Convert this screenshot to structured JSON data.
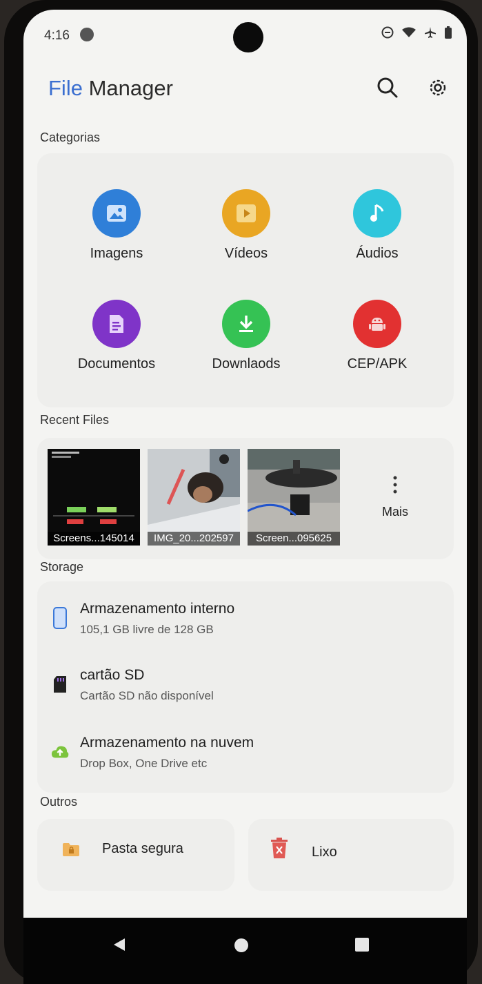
{
  "status": {
    "time": "4:16"
  },
  "header": {
    "title_accent": "File",
    "title_rest": "Manager",
    "search_icon": "search-icon",
    "settings_icon": "gear-icon"
  },
  "categories": {
    "label": "Categorias",
    "items": [
      {
        "label": "Imagens",
        "icon": "image-icon",
        "color": "#2f7fd8"
      },
      {
        "label": "Vídeos",
        "icon": "play-icon",
        "color": "#e9a623"
      },
      {
        "label": "Áudios",
        "icon": "music-note-icon",
        "color": "#2fc6dc"
      },
      {
        "label": "Documentos",
        "icon": "document-icon",
        "color": "#7f34c8"
      },
      {
        "label": "Downlaods",
        "icon": "download-icon",
        "color": "#35c254"
      },
      {
        "label": "CEP/APK",
        "icon": "android-icon",
        "color": "#e23131"
      }
    ]
  },
  "recent": {
    "label": "Recent Files",
    "files": [
      {
        "name": "Screens...145014"
      },
      {
        "name": "IMG_20...202597"
      },
      {
        "name": "Screen...095625"
      }
    ],
    "more_label": "Mais"
  },
  "storage": {
    "label": "Storage",
    "items": [
      {
        "name": "Armazenamento interno",
        "desc": "105,1 GB livre de 128 GB",
        "icon": "phone-icon"
      },
      {
        "name": "cartão SD",
        "desc": "Cartão SD não disponível",
        "icon": "sd-card-icon"
      },
      {
        "name": "Armazenamento na nuvem",
        "desc": "Drop Box, One Drive etc",
        "icon": "cloud-upload-icon"
      }
    ]
  },
  "others": {
    "label": "Outros",
    "secure_folder": "Pasta segura",
    "trash": "Lixo"
  },
  "navbar": {
    "back": "back-icon",
    "home": "home-icon",
    "recents": "recents-icon"
  }
}
